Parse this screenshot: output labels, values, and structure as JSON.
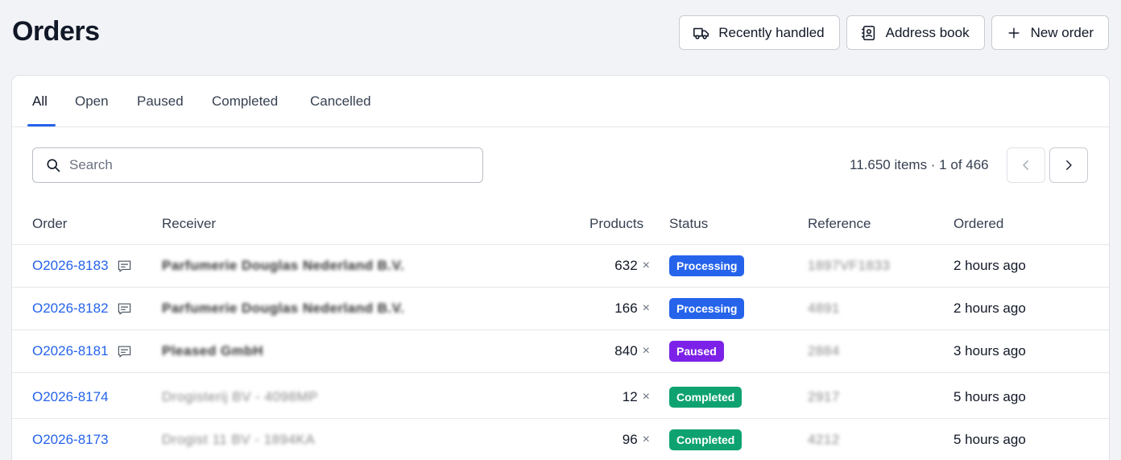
{
  "page": {
    "title": "Orders"
  },
  "actions": {
    "recently_handled": "Recently handled",
    "address_book": "Address book",
    "new_order": "New order"
  },
  "tabs": [
    "All",
    "Open",
    "Paused",
    "Completed",
    "Cancelled"
  ],
  "active_tab": "All",
  "search": {
    "placeholder": "Search",
    "value": ""
  },
  "pagination": {
    "summary": "11.650 items · 1 of 466",
    "total_items": "11.650",
    "page": 1,
    "pages": 466
  },
  "columns": {
    "order": "Order",
    "receiver": "Receiver",
    "products": "Products",
    "status": "Status",
    "reference": "Reference",
    "ordered": "Ordered"
  },
  "status_colors": {
    "Processing": "#2563eb",
    "Paused": "#7c22e8",
    "Completed": "#0ea271"
  },
  "rows": [
    {
      "order": "O2026-8183",
      "has_comment": true,
      "receiver": "Parfumerie Douglas Nederland B.V.",
      "products": "632",
      "status": "Processing",
      "reference": "1897VF1833",
      "ordered": "2 hours ago"
    },
    {
      "order": "O2026-8182",
      "has_comment": true,
      "receiver": "Parfumerie Douglas Nederland B.V.",
      "products": "166",
      "status": "Processing",
      "reference": "4891",
      "ordered": "2 hours ago"
    },
    {
      "order": "O2026-8181",
      "has_comment": true,
      "receiver": "Pleased GmbH",
      "products": "840",
      "status": "Paused",
      "reference": "2884",
      "ordered": "3 hours ago"
    },
    {
      "order": "O2026-8174",
      "has_comment": false,
      "receiver": "Drogisterij BV - 4098MP",
      "products": "12",
      "status": "Completed",
      "reference": "2917",
      "ordered": "5 hours ago"
    },
    {
      "order": "O2026-8173",
      "has_comment": false,
      "receiver": "Drogist 11 BV - 1894KA",
      "products": "96",
      "status": "Completed",
      "reference": "4212",
      "ordered": "5 hours ago"
    }
  ],
  "product_suffix": "×"
}
